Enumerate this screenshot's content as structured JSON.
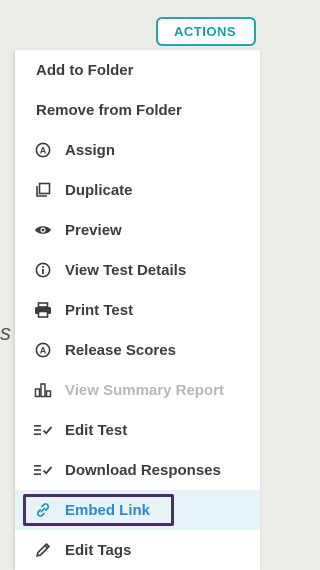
{
  "actions_button": {
    "label": "ACTIONS"
  },
  "menu": {
    "items": [
      {
        "label": "Add to Folder",
        "icon": ""
      },
      {
        "label": "Remove from Folder",
        "icon": ""
      },
      {
        "label": "Assign",
        "icon": "circle-a-icon"
      },
      {
        "label": "Duplicate",
        "icon": "duplicate-icon"
      },
      {
        "label": "Preview",
        "icon": "eye-icon"
      },
      {
        "label": "View Test Details",
        "icon": "info-icon"
      },
      {
        "label": "Print Test",
        "icon": "printer-icon"
      },
      {
        "label": "Release Scores",
        "icon": "circle-a-icon"
      },
      {
        "label": "View Summary Report",
        "icon": "bar-chart-icon",
        "disabled": true
      },
      {
        "label": "Edit Test",
        "icon": "list-check-icon"
      },
      {
        "label": "Download Responses",
        "icon": "list-check-icon"
      },
      {
        "label": "Embed Link",
        "icon": "link-icon",
        "highlighted": true
      },
      {
        "label": "Edit Tags",
        "icon": "pencil-icon"
      }
    ]
  },
  "background_fragment": "s",
  "colors": {
    "accent": "#25a6a9",
    "highlight_bg": "#e6f4f8",
    "highlight_text": "#2f89c4",
    "focus_border": "#4e2a74",
    "disabled_text": "#b8b8b8"
  }
}
